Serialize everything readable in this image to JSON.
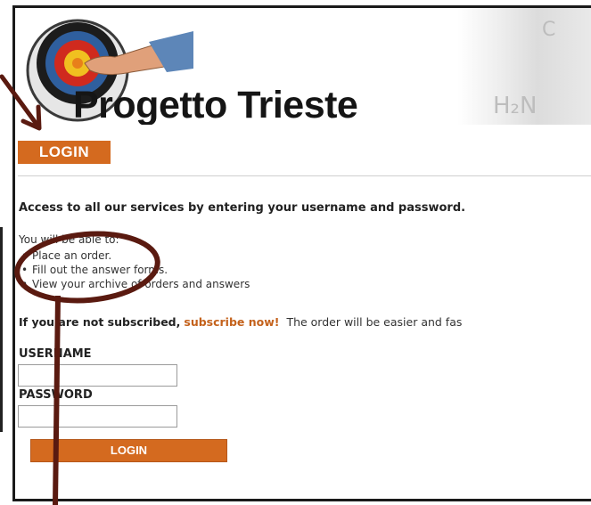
{
  "header": {
    "site_title": "Progetto Trieste",
    "chem_text": "H₂N"
  },
  "login_tab": "LOGIN",
  "headline": "Access to all our services by entering your username and password.",
  "intro": "You will be able to:",
  "benefits": [
    "Place an order.",
    "Fill out the answer forms.",
    "View your archive of orders and answers"
  ],
  "subscribe": {
    "prefix": "If you are not subscribed,",
    "link": "subscribe now!",
    "suffix": "The order will be easier and fas"
  },
  "form": {
    "username_label": "USERNAME",
    "username_value": "",
    "password_label": "PASSWORD",
    "password_value": "",
    "submit_label": "LOGIN"
  },
  "colors": {
    "accent": "#d46a1f",
    "annotation": "#5a1a10"
  },
  "icons": [
    "target-logo-icon",
    "pointing-hand-icon"
  ]
}
